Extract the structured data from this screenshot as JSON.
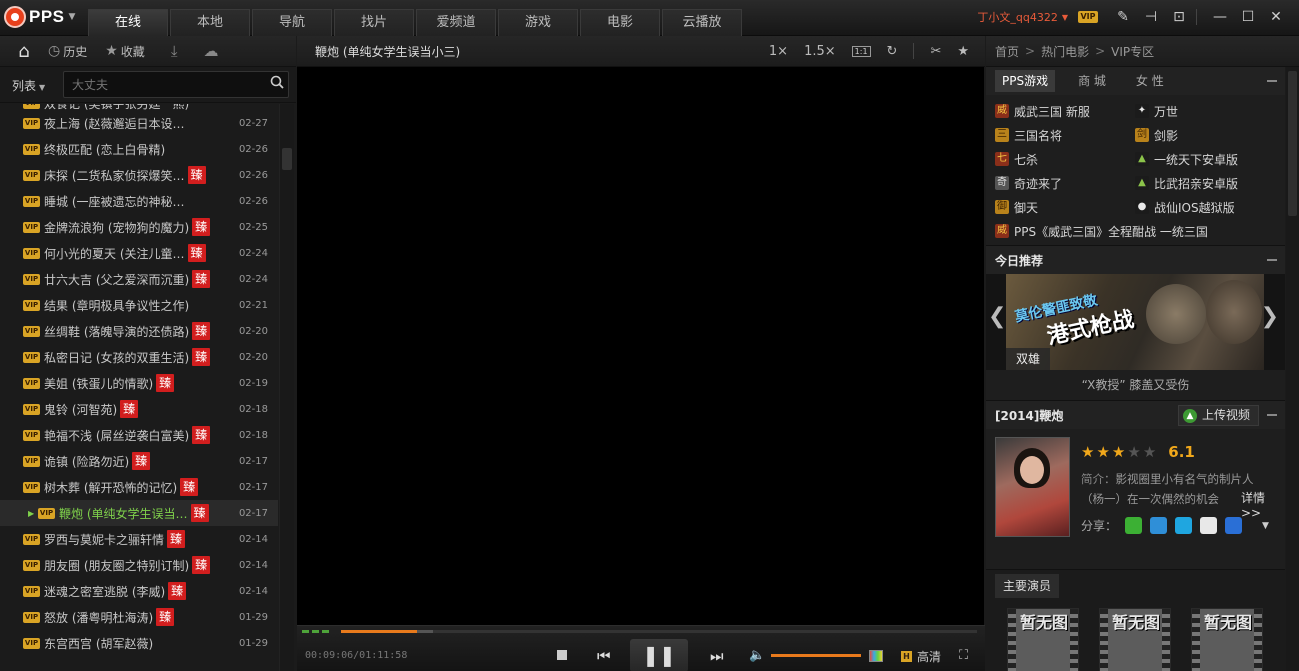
{
  "app": {
    "logo_text": "PPS"
  },
  "nav_tabs": [
    {
      "label": "在线",
      "active": true
    },
    {
      "label": "本地"
    },
    {
      "label": "导航"
    },
    {
      "label": "找片"
    },
    {
      "label": "爱频道"
    },
    {
      "label": "游戏"
    },
    {
      "label": "电影"
    },
    {
      "label": "云播放"
    }
  ],
  "user": {
    "name": "丁小文_qq4322",
    "vip_badge": "VIP"
  },
  "left_toolbar": {
    "history": "历史",
    "favorites": "收藏"
  },
  "list": {
    "selector_label": "列表",
    "search_placeholder": "大丈夫"
  },
  "playlist": [
    {
      "title": "双食记 (吴镇宇张另廷一熊)",
      "date": "",
      "tag": ""
    },
    {
      "title": "夜上海 (赵薇邂逅日本设计师)",
      "date": "02-27",
      "tag": ""
    },
    {
      "title": "终极匹配 (恋上白骨精)",
      "date": "02-26",
      "tag": ""
    },
    {
      "title": "床探 (二货私家侦探爆笑…",
      "date": "02-26",
      "tag": "臻"
    },
    {
      "title": "睡城 (一座被遗忘的神秘古城)",
      "date": "02-26",
      "tag": ""
    },
    {
      "title": "金牌流浪狗 (宠物狗的魔力)",
      "date": "02-25",
      "tag": "臻"
    },
    {
      "title": "何小光的夏天 (关注儿童…",
      "date": "02-24",
      "tag": "臻"
    },
    {
      "title": "廿六大吉 (父之爱深而沉重)",
      "date": "02-24",
      "tag": "臻"
    },
    {
      "title": "结果 (章明极具争议性之作)",
      "date": "02-21",
      "tag": ""
    },
    {
      "title": "丝绸鞋 (落魄导演的还债路)",
      "date": "02-20",
      "tag": "臻"
    },
    {
      "title": "私密日记 (女孩的双重生活)",
      "date": "02-20",
      "tag": "臻"
    },
    {
      "title": "美姐 (铁蛋儿的情歌)",
      "date": "02-19",
      "tag": "臻"
    },
    {
      "title": "鬼铃 (河智苑)",
      "date": "02-18",
      "tag": "臻"
    },
    {
      "title": "艳福不浅 (屌丝逆袭白富美)",
      "date": "02-18",
      "tag": "臻"
    },
    {
      "title": "诡镇 (险路勿近)",
      "date": "02-17",
      "tag": "臻"
    },
    {
      "title": "树木葬 (解开恐怖的记忆)",
      "date": "02-17",
      "tag": "臻"
    },
    {
      "title": "鞭炮 (单纯女学生误当…",
      "date": "02-17",
      "tag": "臻",
      "active": true
    },
    {
      "title": "罗西与莫妮卡之骊轩情",
      "date": "02-14",
      "tag": "臻"
    },
    {
      "title": "朋友圈 (朋友圈之特别订制)",
      "date": "02-14",
      "tag": "臻"
    },
    {
      "title": "迷魂之密室逃脱 (李威)",
      "date": "02-14",
      "tag": "臻"
    },
    {
      "title": "怒放 (潘粤明杜海涛)",
      "date": "01-29",
      "tag": "臻"
    },
    {
      "title": "东宫西宫 (胡军赵薇)",
      "date": "01-29",
      "tag": ""
    }
  ],
  "player": {
    "title": "鞭炮 (单纯女学生误当小三)",
    "speed1": "1×",
    "speed2": "1.5×",
    "time": "00:09:06/01:11:58",
    "quality": "高清",
    "progress": 0.12,
    "volume": 1.0
  },
  "breadcrumb": {
    "home": "首页",
    "cat": "热门电影",
    "zone": "VIP专区"
  },
  "games": {
    "tabs": [
      "PPS游戏",
      "商 城",
      "女 性"
    ],
    "items": [
      {
        "label": "威武三国 新服",
        "icon": "game-icon"
      },
      {
        "label": "万世",
        "icon": "game-icon"
      },
      {
        "label": "三国名将",
        "icon": "game-icon"
      },
      {
        "label": "剑影",
        "icon": "game-icon"
      },
      {
        "label": "七杀",
        "icon": "game-icon"
      },
      {
        "label": "一统天下安卓版",
        "icon": "android-icon"
      },
      {
        "label": "奇迹来了",
        "icon": "game-icon"
      },
      {
        "label": "比武招亲安卓版",
        "icon": "android-icon"
      },
      {
        "label": "御天",
        "icon": "game-icon"
      },
      {
        "label": "战仙IOS越狱版",
        "icon": "apple-icon"
      }
    ],
    "wide_item": "PPS《威武三国》全程酣战 一统三国"
  },
  "today": {
    "header": "今日推荐",
    "banner_line1": "莫伦警匪致敬",
    "banner_line2": "港式枪战",
    "banner_tag": "双雄",
    "caption": "“X教授” 膝盖又受伤"
  },
  "movie": {
    "header": "[2014]鞭炮",
    "upload": "上传视频",
    "rating_stars": 3,
    "score": "6.1",
    "synopsis_label": "简介：",
    "synopsis_line1": "影视圈里小有名气的制片人",
    "synopsis_line2": "（杨一）在一次偶然的机会",
    "details": "详情>>",
    "share": "分享："
  },
  "cast": {
    "tab": "主要演员",
    "placeholder": "暂无图"
  },
  "colors": {
    "accent": "#e87a1c",
    "active_green": "#7fd14b",
    "tag_red": "#d21e1e",
    "vip_gold": "#d9a425"
  }
}
